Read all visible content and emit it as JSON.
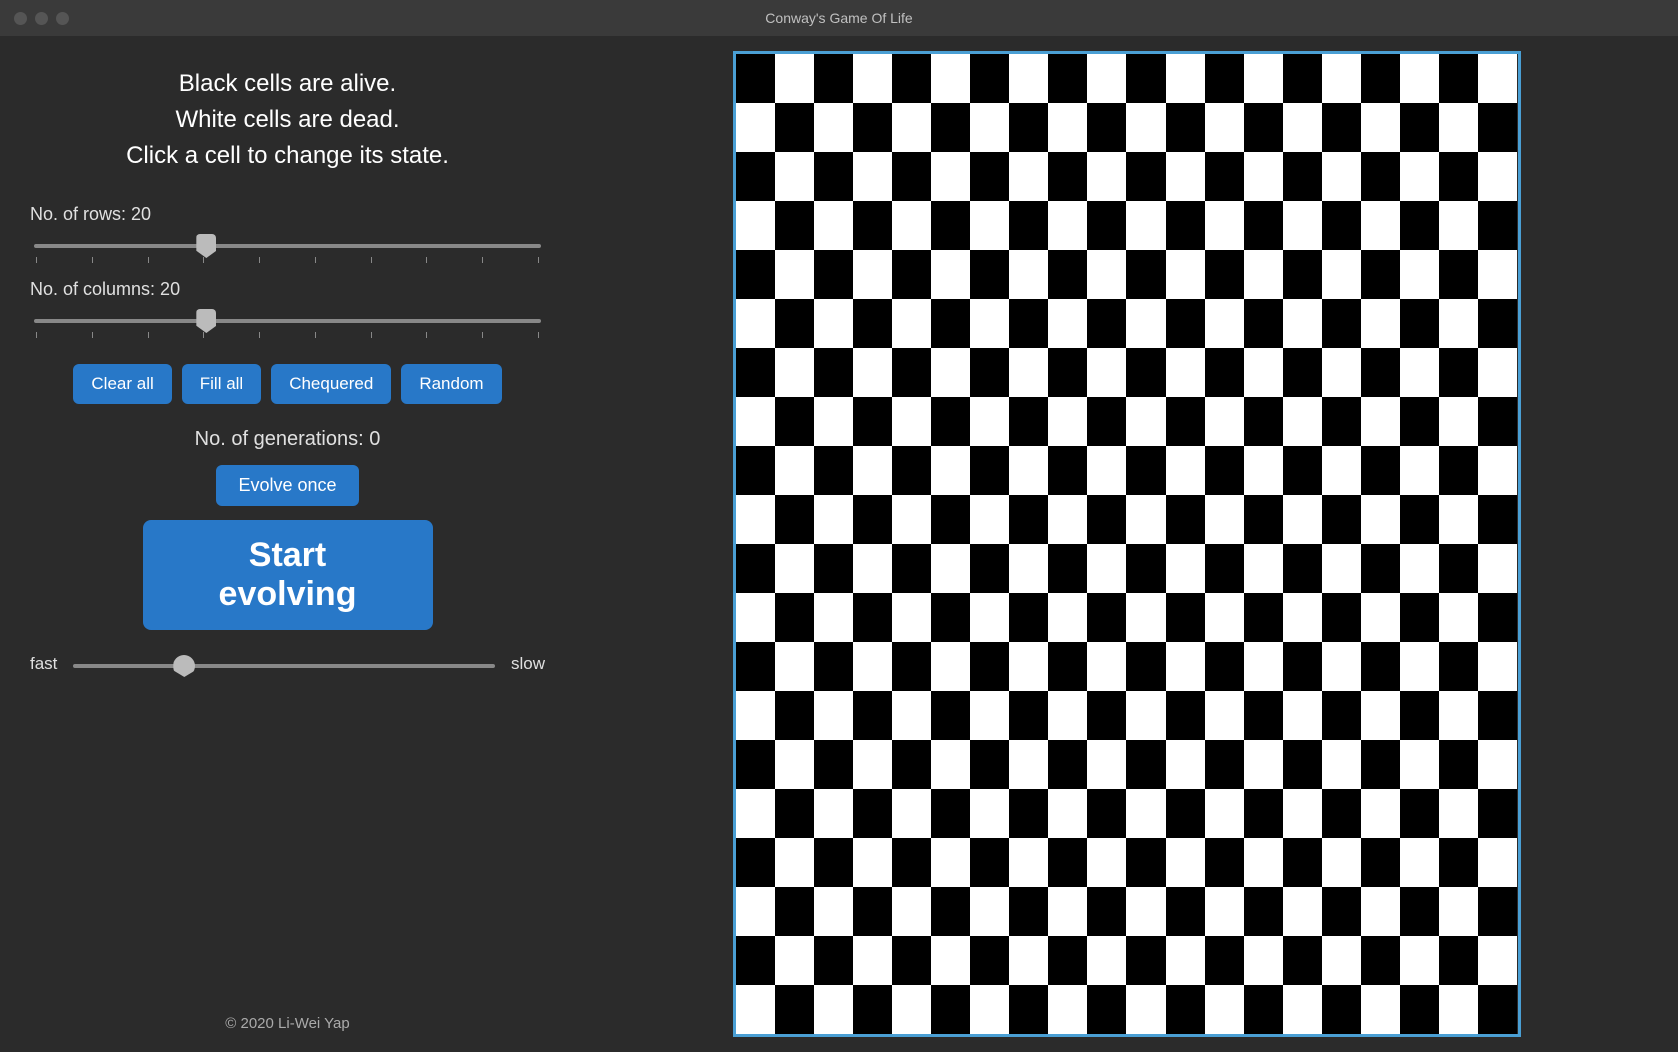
{
  "titlebar": {
    "title": "Conway's Game Of Life"
  },
  "instructions": {
    "line1": "Black cells are alive.",
    "line2": "White cells are dead.",
    "line3": "Click a cell to change its state."
  },
  "rows": {
    "label": "No. of rows: 20",
    "value": 20,
    "min": 5,
    "max": 50
  },
  "columns": {
    "label": "No. of columns: 20",
    "value": 20,
    "min": 5,
    "max": 50
  },
  "buttons": {
    "clear_all": "Clear all",
    "fill_all": "Fill all",
    "chequered": "Chequered",
    "random": "Random",
    "evolve_once": "Evolve once",
    "start_evolving": "Start evolving"
  },
  "generations": {
    "label": "No. of generations: 0"
  },
  "speed": {
    "fast_label": "fast",
    "slow_label": "slow",
    "value": 25
  },
  "copyright": "© 2020 Li-Wei Yap",
  "grid": {
    "rows": 20,
    "cols": 20
  }
}
